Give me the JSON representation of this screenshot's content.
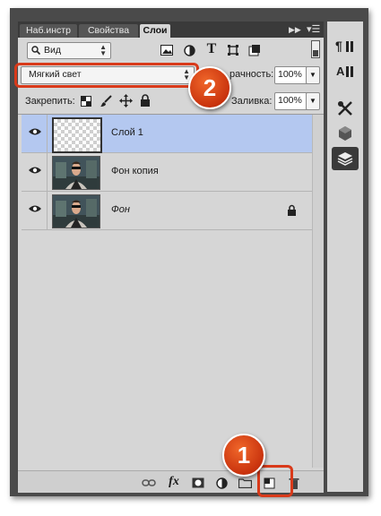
{
  "tabs": [
    {
      "label": "Наб.инстр",
      "active": false
    },
    {
      "label": "Свойства",
      "active": false
    },
    {
      "label": "Слои",
      "active": true
    }
  ],
  "filter": {
    "kind_label": "Вид"
  },
  "blend_mode": {
    "value": "Мягкий свет"
  },
  "opacity": {
    "label": "Непрозрачность:",
    "visible_label": "рачность:",
    "value": "100%"
  },
  "lock": {
    "label": "Закрепить:"
  },
  "fill": {
    "label": "Заливка:",
    "value": "100%"
  },
  "layers": [
    {
      "name": "Слой 1",
      "selected": true,
      "thumb": "transparent",
      "locked": false,
      "italic": false
    },
    {
      "name": "Фон копия",
      "selected": false,
      "thumb": "photo",
      "locked": false,
      "italic": false
    },
    {
      "name": "Фон",
      "selected": false,
      "thumb": "photo",
      "locked": true,
      "italic": true
    }
  ],
  "callouts": {
    "one": "1",
    "two": "2"
  },
  "colors": {
    "selected_row": "#b4c8f0",
    "callout": "#d9461f",
    "panel": "#d6d6d6"
  },
  "icons": {
    "bottom": [
      "link-icon",
      "fx-icon",
      "mask-icon",
      "adjustment-icon",
      "folder-icon",
      "new-layer-icon",
      "trash-icon"
    ],
    "right": [
      "paragraph-styles-icon",
      "character-styles-icon",
      "tools-icon",
      "3d-icon",
      "layers-icon"
    ]
  }
}
